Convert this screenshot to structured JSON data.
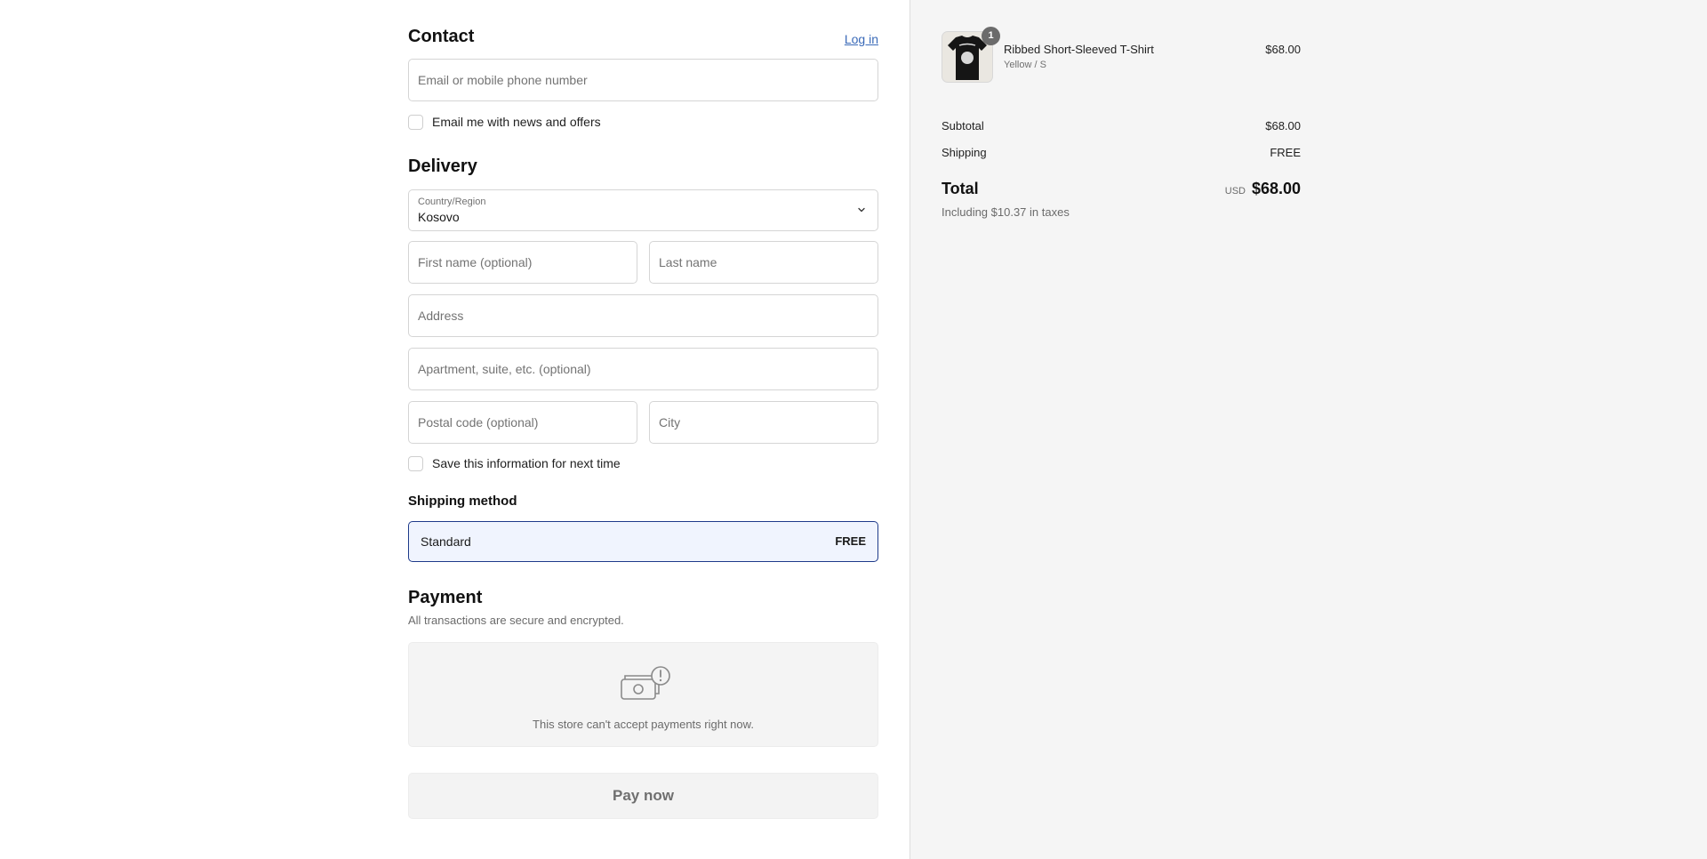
{
  "contact": {
    "title": "Contact",
    "login_link": "Log in",
    "email_placeholder": "Email or mobile phone number",
    "news_checkbox_label": "Email me with news and offers",
    "news_checked": false
  },
  "delivery": {
    "title": "Delivery",
    "country_label": "Country/Region",
    "country_value": "Kosovo",
    "first_name_placeholder": "First name (optional)",
    "last_name_placeholder": "Last name",
    "address_placeholder": "Address",
    "apartment_placeholder": "Apartment, suite, etc. (optional)",
    "postal_placeholder": "Postal code (optional)",
    "city_placeholder": "City",
    "save_info_label": "Save this information for next time",
    "save_info_checked": false
  },
  "shipping_method": {
    "title": "Shipping method",
    "option_name": "Standard",
    "option_price": "FREE",
    "selected": true
  },
  "payment": {
    "title": "Payment",
    "subtitle": "All transactions are secure and encrypted.",
    "unavailable_message": "This store can't accept payments right now.",
    "icon": "cash-warning-icon",
    "pay_button": "Pay now"
  },
  "order_summary": {
    "item": {
      "name": "Ribbed Short-Sleeved T-Shirt",
      "variant": "Yellow / S",
      "price": "$68.00",
      "quantity": "1"
    },
    "subtotal_label": "Subtotal",
    "subtotal_value": "$68.00",
    "shipping_label": "Shipping",
    "shipping_value": "FREE",
    "total_label": "Total",
    "total_currency": "USD",
    "total_value": "$68.00",
    "tax_note": "Including $10.37 in taxes"
  },
  "colors": {
    "link": "#3a6ab8",
    "selected_border": "#1e3a8a",
    "selected_bg": "#f0f4fe",
    "summary_bg": "#f5f5f5"
  }
}
